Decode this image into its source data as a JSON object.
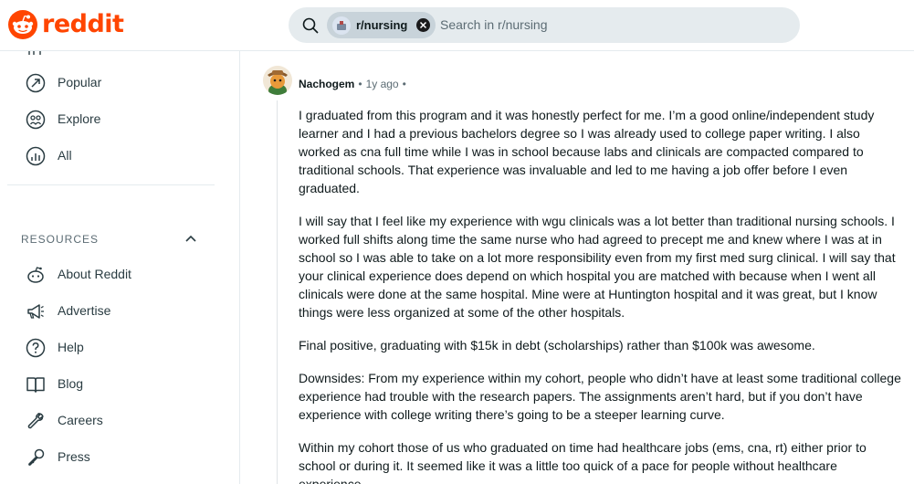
{
  "brand": {
    "name": "reddit",
    "color": "#ff4500"
  },
  "search": {
    "community_chip": "r/nursing",
    "placeholder": "Search in r/nursing"
  },
  "sidebar": {
    "items": [
      {
        "label": "Popular",
        "icon": "popular-icon"
      },
      {
        "label": "Explore",
        "icon": "explore-icon"
      },
      {
        "label": "All",
        "icon": "all-icon"
      }
    ],
    "resources": {
      "title": "RESOURCES",
      "items": [
        {
          "label": "About Reddit",
          "icon": "reddit-icon"
        },
        {
          "label": "Advertise",
          "icon": "megaphone-icon"
        },
        {
          "label": "Help",
          "icon": "help-icon"
        },
        {
          "label": "Blog",
          "icon": "book-icon"
        },
        {
          "label": "Careers",
          "icon": "wrench-icon"
        },
        {
          "label": "Press",
          "icon": "microphone-icon"
        }
      ]
    }
  },
  "comment": {
    "author": "Nachogem",
    "separator": "•",
    "time": "1y ago",
    "paragraphs": [
      "I graduated from this program and it was honestly perfect for me. I’m a good online/independent study learner and I had a previous bachelors degree so I was already used to college paper writing. I also worked as cna full time while I was in school because labs and clinicals are compacted compared to traditional schools. That experience was invaluable and led to me having a job offer before I even graduated.",
      "I will say that I feel like my experience with wgu clinicals was a lot better than traditional nursing schools. I worked full shifts along time the same nurse who had agreed to precept me and knew where I was at in school so I was able to take on a lot more responsibility even from my first med surg clinical. I will say that your clinical experience does depend on which hospital you are matched with because when I went all clinicals were done at the same hospital. Mine were at Huntington hospital and it was great, but I know things were less organized at some of the other hospitals.",
      "Final positive, graduating with $15k in debt (scholarships) rather than $100k was awesome.",
      "Downsides: From my experience within my cohort, people who didn’t have at least some traditional college experience had trouble with the research papers. The assignments aren’t hard, but if you don’t have experience with college writing there’s going to be a steeper learning curve.",
      "Within my cohort those of us who graduated on time had healthcare jobs (ems, cna, rt) either prior to school or during it. It seemed like it was a little too quick of a pace for people without healthcare experience."
    ]
  }
}
